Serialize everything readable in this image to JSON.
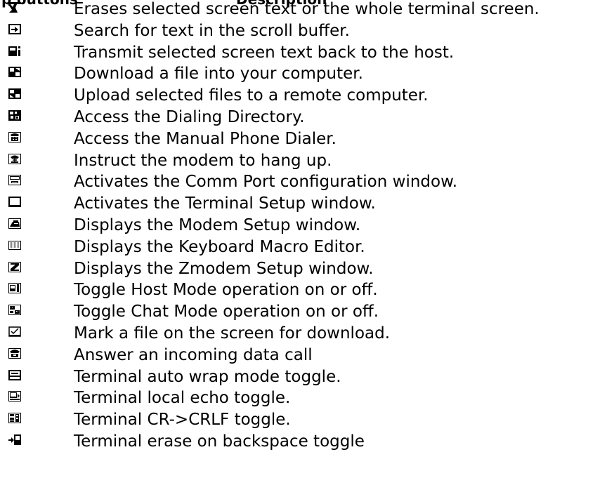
{
  "header": {
    "col1": "p buttons",
    "col2": "Description"
  },
  "rows": [
    {
      "icon": "erase-screen-icon",
      "text": "Erases selected screen text or the whole terminal screen."
    },
    {
      "icon": "search-buffer-icon",
      "text": "Search for text in the scroll buffer."
    },
    {
      "icon": "transmit-text-icon",
      "text": "Transmit selected screen text back to the host."
    },
    {
      "icon": "download-file-icon",
      "text": "Download a file into your computer."
    },
    {
      "icon": "upload-file-icon",
      "text": "Upload selected files to a remote computer."
    },
    {
      "icon": "dialing-directory-icon",
      "text": "Access the Dialing Directory."
    },
    {
      "icon": "manual-dialer-icon",
      "text": "Access the Manual Phone Dialer."
    },
    {
      "icon": "hang-up-icon",
      "text": "Instruct the modem to hang up."
    },
    {
      "icon": "comm-port-icon",
      "text": "Activates the Comm Port configuration window."
    },
    {
      "icon": "terminal-setup-icon",
      "text": "Activates the Terminal Setup window."
    },
    {
      "icon": "modem-setup-icon",
      "text": "Displays the Modem Setup window."
    },
    {
      "icon": "keyboard-macro-icon",
      "text": "Displays the Keyboard Macro Editor."
    },
    {
      "icon": "zmodem-setup-icon",
      "text": "Displays the Zmodem Setup window."
    },
    {
      "icon": "host-mode-icon",
      "text": "Toggle Host Mode operation on or off."
    },
    {
      "icon": "chat-mode-icon",
      "text": "Toggle Chat Mode operation on or off."
    },
    {
      "icon": "mark-file-icon",
      "text": "Mark a file on the screen for download."
    },
    {
      "icon": "answer-call-icon",
      "text": "Answer an incoming data call"
    },
    {
      "icon": "auto-wrap-icon",
      "text": "Terminal auto wrap mode toggle."
    },
    {
      "icon": "local-echo-icon",
      "text": "Terminal local echo toggle."
    },
    {
      "icon": "cr-crlf-icon",
      "text": "Terminal CR->CRLF toggle."
    },
    {
      "icon": "erase-backspace-icon",
      "text": "Terminal erase on backspace toggle"
    }
  ]
}
